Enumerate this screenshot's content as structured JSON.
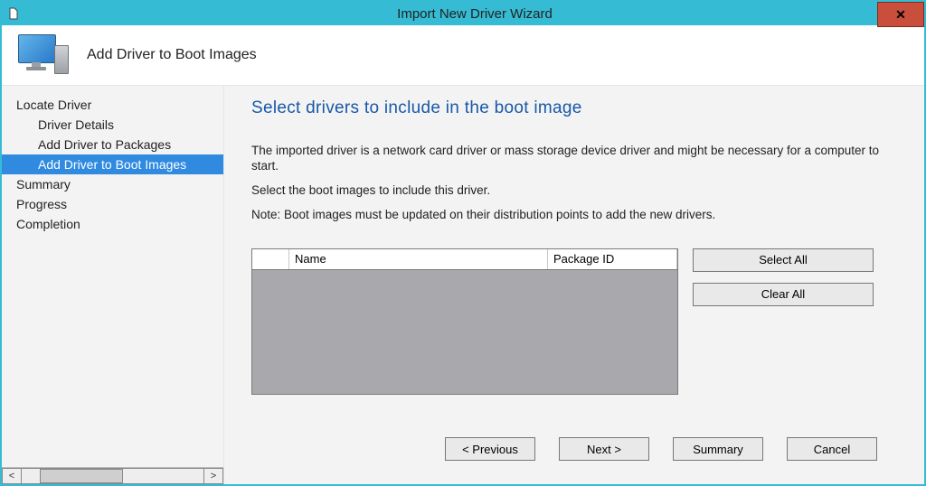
{
  "window": {
    "title": "Import New Driver Wizard"
  },
  "banner": {
    "title": "Add Driver to Boot Images"
  },
  "nav": {
    "items": [
      {
        "label": "Locate Driver",
        "selected": false
      },
      {
        "label": "Driver Details",
        "selected": false
      },
      {
        "label": "Add Driver to Packages",
        "selected": false
      },
      {
        "label": "Add Driver to Boot Images",
        "selected": true
      },
      {
        "label": "Summary",
        "selected": false
      },
      {
        "label": "Progress",
        "selected": false
      },
      {
        "label": "Completion",
        "selected": false
      }
    ]
  },
  "content": {
    "heading": "Select drivers to include in the boot image",
    "paragraphs": [
      "The imported driver is a network card driver or mass storage device driver and might be necessary for a computer to start.",
      "Select the boot images to include this driver.",
      "Note: Boot images must be updated on their distribution points to add the new drivers."
    ],
    "list": {
      "columns": [
        "Name",
        "Package ID"
      ],
      "rows": []
    },
    "buttons": {
      "select_all": "Select All",
      "clear_all": "Clear All"
    }
  },
  "footer": {
    "previous": "< Previous",
    "next": "Next >",
    "summary": "Summary",
    "cancel": "Cancel"
  }
}
